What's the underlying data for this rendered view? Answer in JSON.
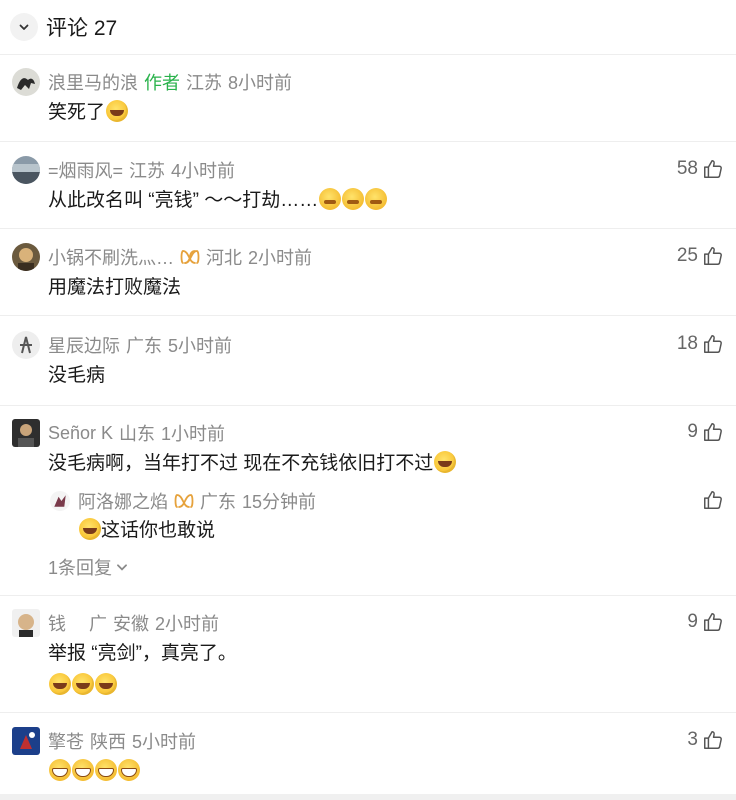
{
  "header": {
    "title": "评论 27"
  },
  "comments": [
    {
      "name": "浪里马的浪",
      "author_tag": "作者",
      "location": "江苏",
      "time": "8小时前",
      "text": "笑死了",
      "likes": ""
    },
    {
      "name": "=烟雨风=",
      "location": "江苏",
      "time": "4小时前",
      "text": "从此改名叫 “亮钱” ～～打劫……",
      "likes": "58"
    },
    {
      "name": "小锅不刷洗灬…",
      "location": "河北",
      "time": "2小时前",
      "text": "用魔法打败魔法",
      "likes": "25"
    },
    {
      "name": "星辰边际",
      "location": "广东",
      "time": "5小时前",
      "text": "没毛病",
      "likes": "18"
    },
    {
      "name": "Señor K",
      "location": "山东",
      "time": "1小时前",
      "text": "没毛病啊，当年打不过 现在不充钱依旧打不过",
      "likes": "9",
      "reply": {
        "name": "阿洛娜之焰",
        "location": "广东",
        "time": "15分钟前",
        "text": "这话你也敢说"
      },
      "more_replies": "1条回复"
    },
    {
      "name": "钱　 广",
      "location": "安徽",
      "time": "2小时前",
      "text": "举报 “亮剑”，真亮了。",
      "likes": "9"
    },
    {
      "name": "擎苍",
      "location": "陕西",
      "time": "5小时前",
      "text": "",
      "likes": "3"
    }
  ],
  "colors": {
    "author_tag": "#29b24b",
    "meta": "#8a8a8a",
    "divider": "#eeeeee"
  },
  "icons": {
    "like": "thumbs-up-icon",
    "expand": "chevron-down-icon"
  }
}
